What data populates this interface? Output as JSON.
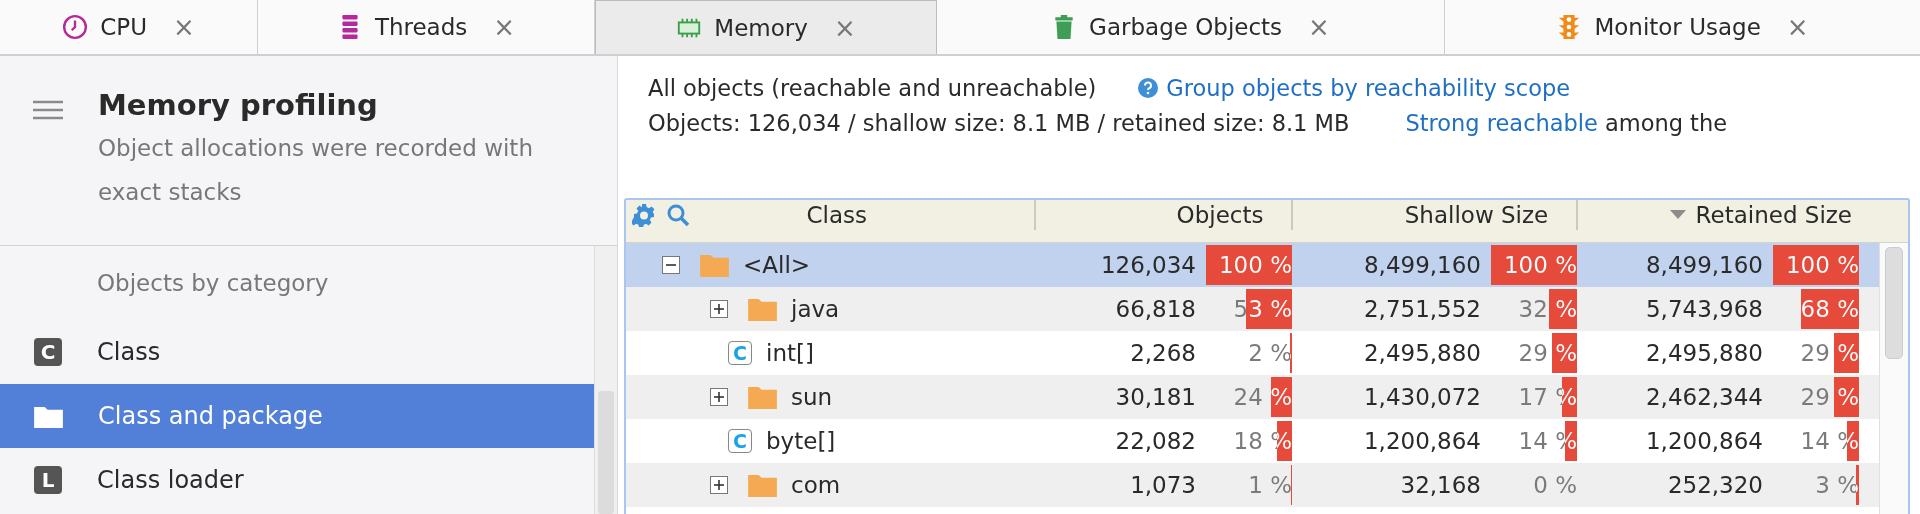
{
  "tabs": [
    {
      "label": "CPU",
      "selected": false
    },
    {
      "label": "Threads",
      "selected": false
    },
    {
      "label": "Memory",
      "selected": true
    },
    {
      "label": "Garbage Objects",
      "selected": false
    },
    {
      "label": "Monitor Usage",
      "selected": false
    }
  ],
  "tab_close": "×",
  "sidebar": {
    "title": "Memory profiling",
    "subtitle": "Object allocations were recorded with exact stacks",
    "section": "Objects by category",
    "items": [
      {
        "label": "Class",
        "kind": "class",
        "badge": "C",
        "selected": false
      },
      {
        "label": "Class and package",
        "kind": "package",
        "selected": true
      },
      {
        "label": "Class loader",
        "kind": "loader",
        "badge": "L",
        "selected": false
      }
    ]
  },
  "summary": {
    "scope": "All objects (reachable and unreachable)",
    "group_link": "Group objects by reachability scope",
    "totals": "Objects: 126,034 / shallow size: 8.1 MB / retained size: 8.1 MB",
    "filter_link": "Strong reachable",
    "filter_rest": "among the"
  },
  "table": {
    "columns": [
      {
        "label": "Class"
      },
      {
        "label": "Objects"
      },
      {
        "label": "Shallow Size"
      },
      {
        "label": "Retained Size",
        "sorted": true
      }
    ],
    "rows": [
      {
        "name": "<All>",
        "kind": "folder",
        "expanded": true,
        "selected": true,
        "objects": {
          "value": "126,034",
          "percent": "100 %"
        },
        "shallow": {
          "value": "8,499,160",
          "percent": "100 %"
        },
        "retained": {
          "value": "8,499,160",
          "percent": "100 %"
        },
        "children": [
          {
            "name": "java",
            "kind": "folder",
            "expanded": false,
            "selected": false,
            "objects": {
              "value": "66,818",
              "percent": "53 %"
            },
            "shallow": {
              "value": "2,751,552",
              "percent": "32 %"
            },
            "retained": {
              "value": "5,743,968",
              "percent": "68 %"
            }
          },
          {
            "name": "int[]",
            "kind": "class",
            "badge": "C",
            "selected": false,
            "objects": {
              "value": "2,268",
              "percent": "2 %"
            },
            "shallow": {
              "value": "2,495,880",
              "percent": "29 %"
            },
            "retained": {
              "value": "2,495,880",
              "percent": "29 %"
            }
          },
          {
            "name": "sun",
            "kind": "folder",
            "expanded": false,
            "selected": false,
            "objects": {
              "value": "30,181",
              "percent": "24 %"
            },
            "shallow": {
              "value": "1,430,072",
              "percent": "17 %"
            },
            "retained": {
              "value": "2,462,344",
              "percent": "29 %"
            }
          },
          {
            "name": "byte[]",
            "kind": "class",
            "badge": "C",
            "selected": false,
            "objects": {
              "value": "22,082",
              "percent": "18 %"
            },
            "shallow": {
              "value": "1,200,864",
              "percent": "14 %"
            },
            "retained": {
              "value": "1,200,864",
              "percent": "14 %"
            }
          },
          {
            "name": "com",
            "kind": "folder",
            "expanded": false,
            "selected": false,
            "objects": {
              "value": "1,073",
              "percent": "1 %"
            },
            "shallow": {
              "value": "32,168",
              "percent": "0 %"
            },
            "retained": {
              "value": "252,320",
              "percent": "3 %"
            }
          }
        ]
      }
    ]
  }
}
